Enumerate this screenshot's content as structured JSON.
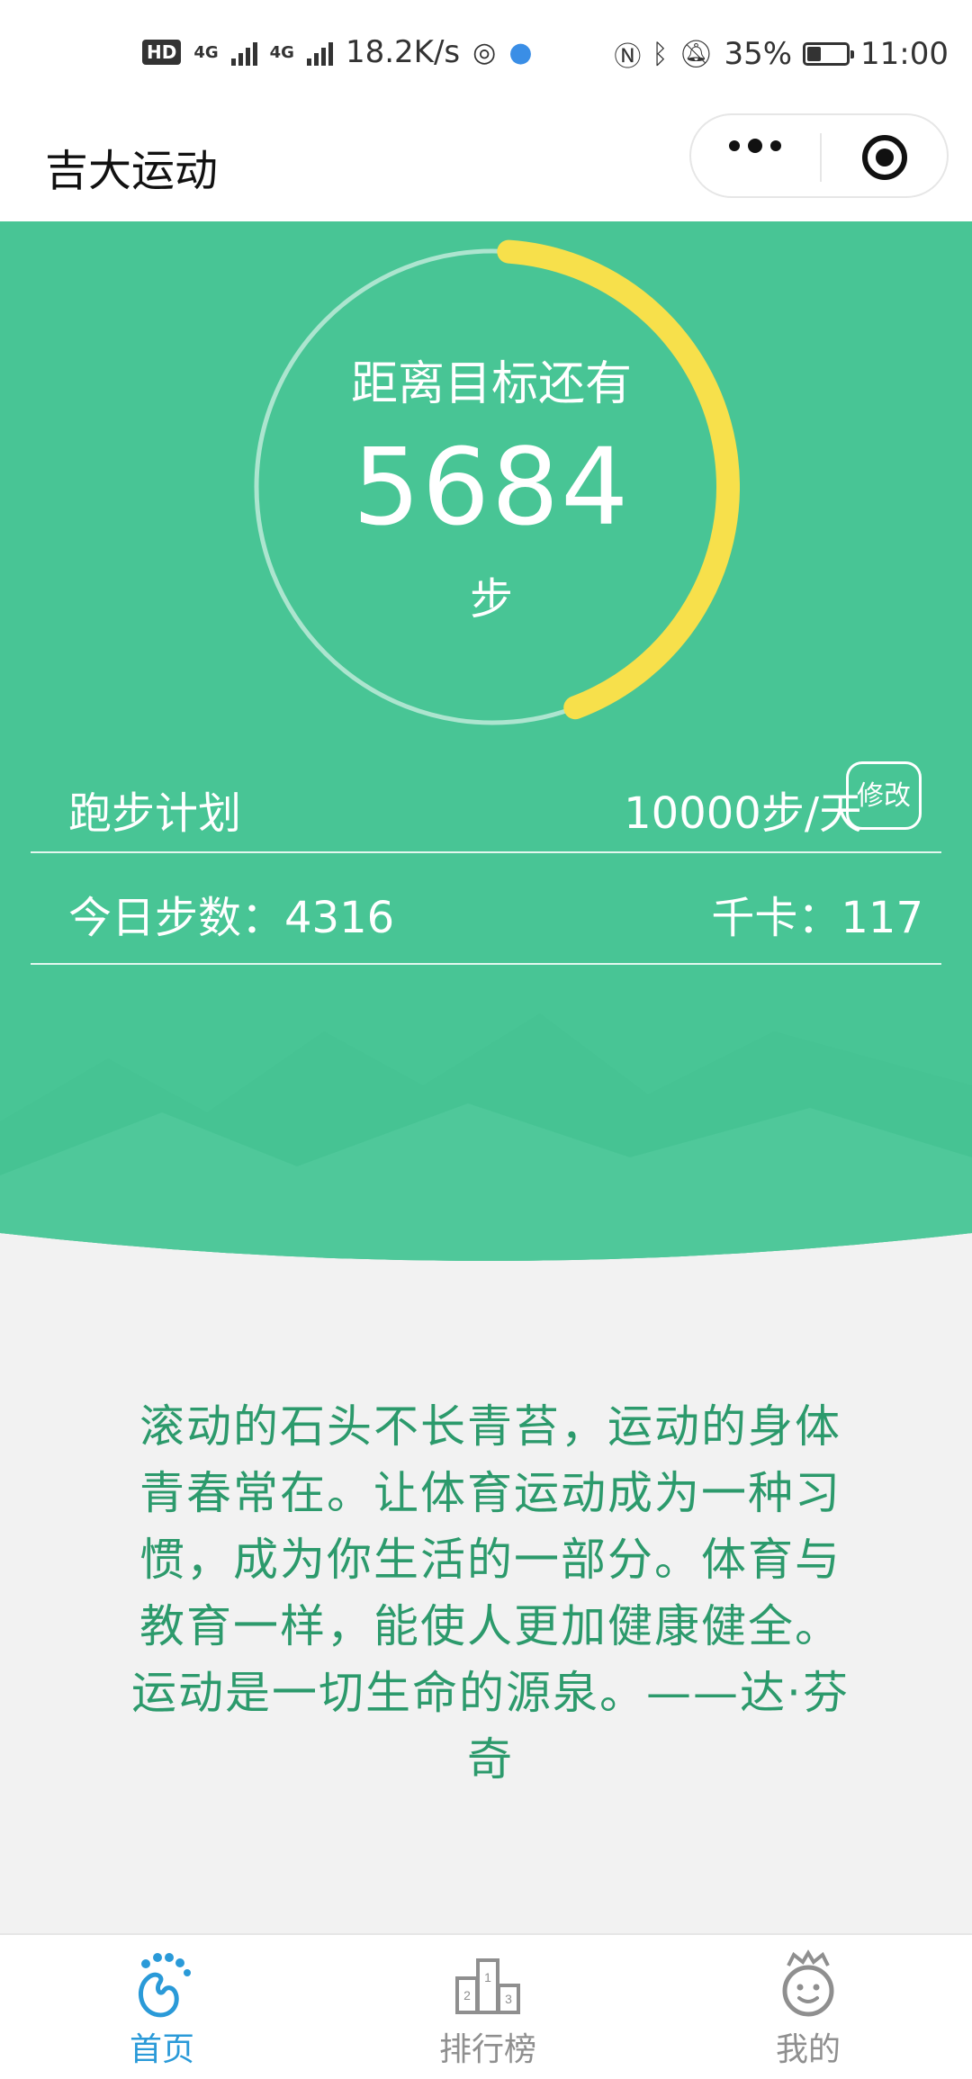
{
  "status_bar": {
    "hd": "HD",
    "net1": "4G",
    "net2": "4G",
    "speed": "18.2K/s",
    "battery": "35%",
    "battery_level": 0.35,
    "time": "11:00"
  },
  "navbar": {
    "title": "吉大运动"
  },
  "goal": {
    "label": "距离目标还有",
    "remaining": "5684",
    "unit": "步",
    "progress": 0.4316
  },
  "plan": {
    "label": "跑步计划",
    "value": "10000步/天",
    "edit_label": "修改"
  },
  "today": {
    "steps_label": "今日步数：4316",
    "kcal_label": "千卡：117"
  },
  "quote": {
    "text": "滚动的石头不长青苔，运动的身体青春常在。让体育运动成为一种习惯，成为你生活的一部分。体育与教育一样，能使人更加健康健全。运动是一切生命的源泉。——达·芬奇"
  },
  "tabs": [
    {
      "label": "首页",
      "icon": "footprint-icon",
      "active": true
    },
    {
      "label": "排行榜",
      "icon": "podium-icon",
      "active": false
    },
    {
      "label": "我的",
      "icon": "smiley-icon",
      "active": false
    }
  ],
  "colors": {
    "accent_green": "#48c595",
    "ring_yellow": "#f7e04b",
    "quote_green": "#2c9a6c",
    "tab_active": "#2a9ad8",
    "tab_inactive": "#8f8f8f"
  }
}
